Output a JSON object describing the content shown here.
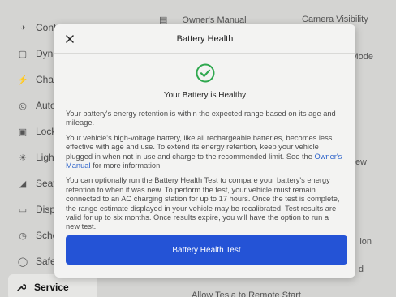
{
  "background": {
    "sidebar_items": [
      {
        "label": "Cont",
        "icon": "toggle-icon"
      },
      {
        "label": "Dyna",
        "icon": "car-icon"
      },
      {
        "label": "Char",
        "icon": "bolt-icon"
      },
      {
        "label": "Auto",
        "icon": "steering-wheel-icon"
      },
      {
        "label": "Lock",
        "icon": "lock-icon"
      },
      {
        "label": "Ligh",
        "icon": "light-icon"
      },
      {
        "label": "Seat",
        "icon": "seat-icon"
      },
      {
        "label": "Disp",
        "icon": "display-icon"
      },
      {
        "label": "Sche",
        "icon": "clock-icon"
      },
      {
        "label": "Safe",
        "icon": "shield-icon"
      },
      {
        "label": "Service",
        "icon": "wrench-icon",
        "active": true
      }
    ],
    "top_links": {
      "owners_manual": "Owner's Manual",
      "camera_visibility": "Camera Visibility"
    },
    "right_fragments": [
      "Mode",
      "ew",
      "ion",
      "d"
    ],
    "bottom_text": "Allow Tesla to Remote Start"
  },
  "modal": {
    "title": "Battery Health",
    "close_icon": "close-icon",
    "status_icon": "check-circle-icon",
    "status_text": "Your Battery is Healthy",
    "paragraph1": "Your battery's energy retention is within the expected range based on its age and mileage.",
    "paragraph2_before": "Your vehicle's high-voltage battery, like all rechargeable batteries, becomes less effective with age and use. To extend its energy retention, keep your vehicle plugged in when not in use and charge to the recommended limit. See the ",
    "paragraph2_link": "Owner's Manual",
    "paragraph2_after": " for more information.",
    "paragraph3": "You can optionally run the Battery Health Test to compare your battery's energy retention to when it was new. To perform the test, your vehicle must remain connected to an AC charging station for up to 17 hours. Once the test is complete, the range estimate displayed in your vehicle may be recalibrated. Test results are valid for up to six months. Once results expire, you will have the option to run a new test.",
    "button_label": "Battery Health Test",
    "colors": {
      "accent": "#2453d6",
      "success": "#2fa84f",
      "link": "#2c62c9"
    }
  }
}
